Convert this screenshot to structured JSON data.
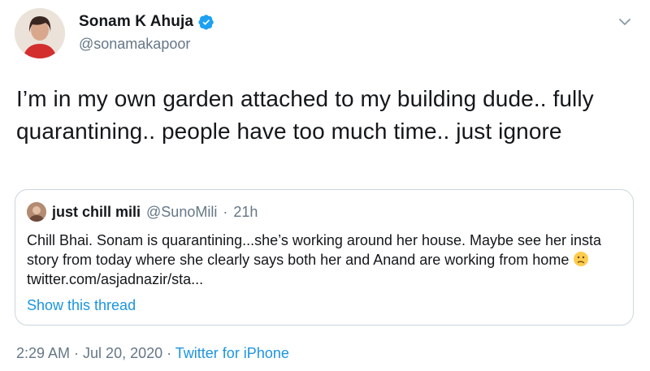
{
  "author": {
    "name": "Sonam K Ahuja",
    "handle": "@sonamakapoor",
    "verified": true
  },
  "tweet": {
    "text": "I’m in my own garden attached to my building dude.. fully quarantining.. people have too much time.. just ignore"
  },
  "quote": {
    "name": "just chill mili",
    "handle": "@SunoMili",
    "separator": "·",
    "time": "21h",
    "text": "Chill Bhai. Sonam is quarantining...she’s working around her house. Maybe see her insta story from today where she clearly says both her and Anand are working from home",
    "link": "twitter.com/asjadnazir/sta...",
    "thread_label": "Show this thread"
  },
  "meta": {
    "time": "2:29 AM",
    "separator1": " · ",
    "date": "Jul 20, 2020",
    "separator2": " · ",
    "source": "Twitter for iPhone"
  },
  "colors": {
    "accent": "#1b95e0",
    "secondary_text": "#657786",
    "border": "#ccd6dd",
    "verified": "#1da1f2"
  },
  "icons": [
    "avatar",
    "verified-badge-icon",
    "chevron-down-icon",
    "confused-face-emoji"
  ]
}
